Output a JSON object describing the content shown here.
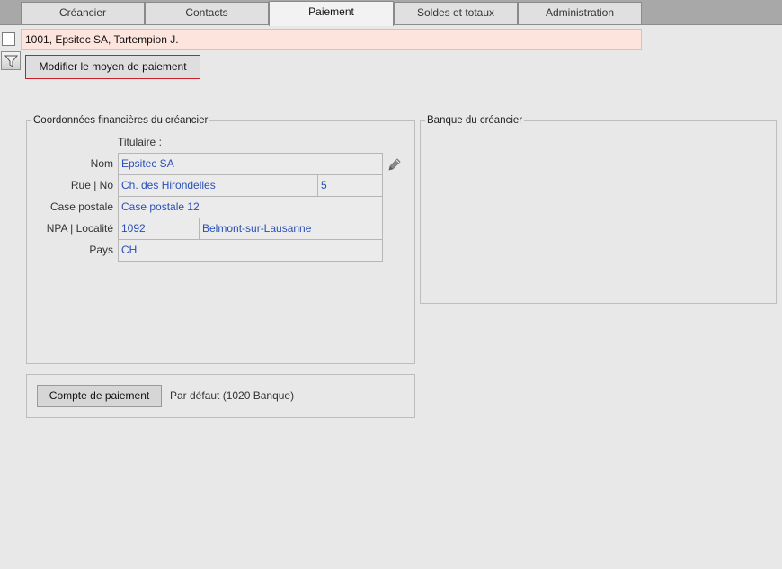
{
  "tabs": [
    {
      "label": "Créancier"
    },
    {
      "label": "Contacts"
    },
    {
      "label": "Paiement"
    },
    {
      "label": "Soldes et totaux"
    },
    {
      "label": "Administration"
    }
  ],
  "active_tab": "Paiement",
  "record": {
    "header": "1001, Epsitec SA, Tartempion J."
  },
  "toolbar": {
    "modify_payment_label": "Modifier le moyen de paiement"
  },
  "financial": {
    "title": "Coordonnées financières du créancier",
    "holder_label": "Titulaire :",
    "name_label": "Nom",
    "name_value": "Epsitec SA",
    "street_label": "Rue | No",
    "street_value": "Ch. des Hirondelles",
    "number_value": "5",
    "pobox_label": "Case postale",
    "pobox_value": "Case postale 12",
    "zip_city_label": "NPA | Localité",
    "zip_value": "1092",
    "city_value": "Belmont-sur-Lausanne",
    "country_label": "Pays",
    "country_value": "CH"
  },
  "bank": {
    "title": "Banque du créancier"
  },
  "payment_account": {
    "button_label": "Compte de paiement",
    "value": "Par défaut (1020 Banque)"
  },
  "icons": {
    "filter": "filter-icon",
    "edit": "pencil-icon"
  }
}
